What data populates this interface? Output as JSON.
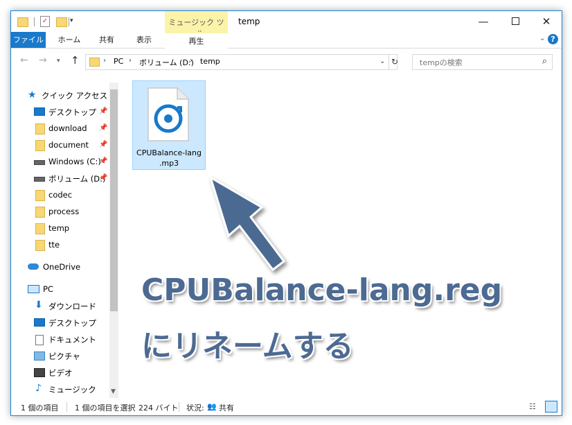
{
  "window": {
    "title": "temp",
    "context_tab_label": "ミュージック ツール"
  },
  "ribbon": {
    "tabs": [
      "ファイル",
      "ホーム",
      "共有",
      "表示",
      "再生"
    ]
  },
  "address": {
    "crumbs": [
      "PC",
      "ボリューム (D:)",
      "temp"
    ]
  },
  "search": {
    "placeholder": "tempの検索"
  },
  "nav": {
    "quick_access": "クイック アクセス",
    "items": [
      {
        "label": "デスクトップ",
        "icon": "desktop-icon",
        "pinned": true
      },
      {
        "label": "download",
        "icon": "folder-icon",
        "pinned": true
      },
      {
        "label": "document",
        "icon": "folder-icon",
        "pinned": true
      },
      {
        "label": "Windows (C:)",
        "icon": "drive-icon",
        "pinned": true
      },
      {
        "label": "ボリューム (D:)",
        "icon": "drive-icon",
        "pinned": true
      },
      {
        "label": "codec",
        "icon": "folder-icon",
        "pinned": false
      },
      {
        "label": "process",
        "icon": "folder-icon",
        "pinned": false
      },
      {
        "label": "temp",
        "icon": "folder-icon",
        "pinned": false
      },
      {
        "label": "tte",
        "icon": "folder-icon",
        "pinned": false
      }
    ],
    "onedrive": "OneDrive",
    "pc": "PC",
    "pc_items": [
      {
        "label": "ダウンロード",
        "icon": "download-icon"
      },
      {
        "label": "デスクトップ",
        "icon": "desktop-icon"
      },
      {
        "label": "ドキュメント",
        "icon": "document-icon"
      },
      {
        "label": "ピクチャ",
        "icon": "picture-icon"
      },
      {
        "label": "ビデオ",
        "icon": "video-icon"
      },
      {
        "label": "ミュージック",
        "icon": "music-icon"
      }
    ]
  },
  "file": {
    "name_line1": "CPUBalance-lang",
    "name_line2": ".mp3"
  },
  "annotation": {
    "line1": "CPUBalance-lang.reg",
    "line2": "にリネームする"
  },
  "status": {
    "count": "1 個の項目",
    "selected": "1 個の項目を選択",
    "size": "224 バイト",
    "state_label": "状況:",
    "state_value": "共有"
  },
  "colors": {
    "accent": "#1979ca",
    "selection": "#cce8ff",
    "annotation": "#4c6a92",
    "context_tab": "#fbf3a8"
  }
}
